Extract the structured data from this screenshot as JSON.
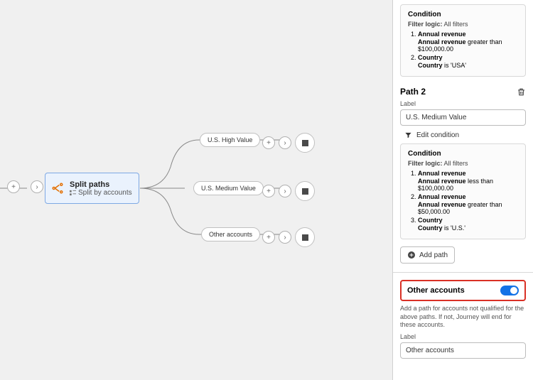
{
  "canvas": {
    "split": {
      "title": "Split paths",
      "subtitle": "Split by accounts"
    },
    "paths": [
      "U.S. High Value",
      "U.S. Medium Value",
      "Other accounts"
    ]
  },
  "sidebar": {
    "path1": {
      "cond_heading": "Condition",
      "filter_label": "Filter logic:",
      "filter_value": "All filters",
      "items": [
        {
          "field": "Annual revenue",
          "sub_field": "Annual revenue",
          "sub_rest": " greater than $100,000.00"
        },
        {
          "field": "Country",
          "sub_field": "Country",
          "sub_rest": " is 'USA'"
        }
      ]
    },
    "path2": {
      "heading": "Path 2",
      "label_text": "Label",
      "label_value": "U.S. Medium Value",
      "edit_text": "Edit condition",
      "cond_heading": "Condition",
      "filter_label": "Filter logic:",
      "filter_value": "All filters",
      "items": [
        {
          "field": "Annual revenue",
          "sub_field": "Annual revenue",
          "sub_rest": " less than $100,000.00"
        },
        {
          "field": "Annual revenue",
          "sub_field": "Annual revenue",
          "sub_rest": " greater than $50,000.00"
        },
        {
          "field": "Country",
          "sub_field": "Country",
          "sub_rest": " is 'U.S.'"
        }
      ]
    },
    "add_path": "Add path",
    "other": {
      "heading": "Other accounts",
      "help": "Add a path for accounts not qualified for the above paths. If not, Journey will end for these accounts.",
      "label_text": "Label",
      "label_value": "Other accounts"
    }
  }
}
